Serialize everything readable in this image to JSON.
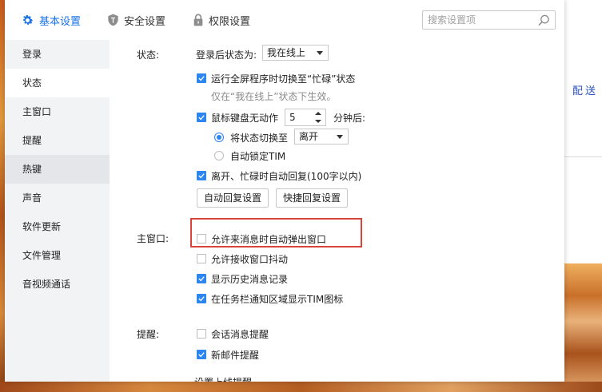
{
  "tabs": [
    {
      "label": "基本设置",
      "icon": "gear-icon",
      "active": true
    },
    {
      "label": "安全设置",
      "icon": "shield-icon",
      "active": false
    },
    {
      "label": "权限设置",
      "icon": "lock-icon",
      "active": false
    }
  ],
  "search": {
    "placeholder": "搜索设置项"
  },
  "sidebar": {
    "items": [
      {
        "label": "登录"
      },
      {
        "label": "状态"
      },
      {
        "label": "主窗口"
      },
      {
        "label": "提醒"
      },
      {
        "label": "热键"
      },
      {
        "label": "声音"
      },
      {
        "label": "软件更新"
      },
      {
        "label": "文件管理"
      },
      {
        "label": "音视频通话"
      }
    ],
    "selected": "状态"
  },
  "status_section": {
    "label": "状态:",
    "after_login_label": "登录后状态为:",
    "after_login_value": "我在线上",
    "fullscreen_busy": {
      "label": "运行全屏程序时切换至“忙碌”状态",
      "checked": true
    },
    "fullscreen_hint": "仅在“我在线上”状态下生效。",
    "idle": {
      "label": "鼠标键盘无动作",
      "checked": true,
      "minutes": "5",
      "suffix": "分钟后:"
    },
    "switch_to": {
      "label": "将状态切换至",
      "value": "离开",
      "selected": true
    },
    "auto_lock": {
      "label": "自动锁定TIM",
      "selected": false
    },
    "auto_reply": {
      "label": "离开、忙碌时自动回复(100字以内)",
      "checked": true
    },
    "auto_reply_button": "自动回复设置",
    "quick_reply_button": "快捷回复设置"
  },
  "main_window_section": {
    "label": "主窗口:",
    "options": [
      {
        "label": "允许来消息时自动弹出窗口",
        "checked": false
      },
      {
        "label": "允许接收窗口抖动",
        "checked": false
      },
      {
        "label": "显示历史消息记录",
        "checked": true
      },
      {
        "label": "在任务栏通知区域显示TIM图标",
        "checked": true
      }
    ]
  },
  "reminder_section": {
    "label": "提醒:",
    "options": [
      {
        "label": "会话消息提醒",
        "checked": false
      },
      {
        "label": "新邮件提醒",
        "checked": true
      }
    ],
    "cut_off_text": "设置上线提醒"
  },
  "background": {
    "side_text": "配送"
  },
  "colors": {
    "accent": "#2d86f0",
    "highlight_border": "#d9433b",
    "sidebar_bg": "#f2f3f5"
  }
}
